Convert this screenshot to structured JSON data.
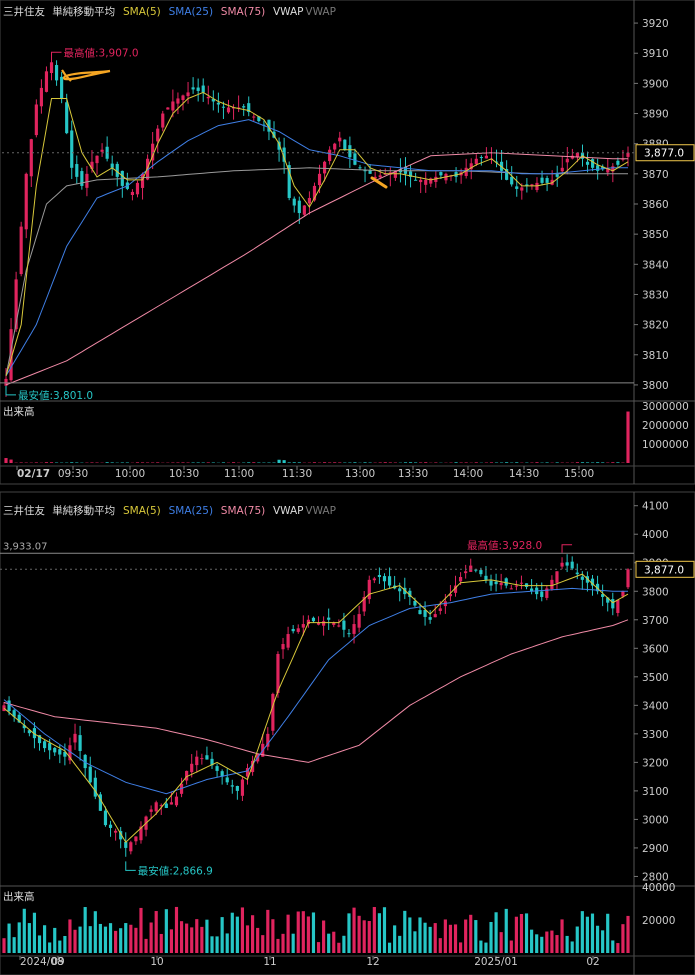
{
  "colors": {
    "up": "#e0245e",
    "down": "#26c6c6",
    "sma5": "#d8c83a",
    "sma25": "#3f7fe6",
    "sma75": "#f08aa6",
    "vwap": "#9a9a9a",
    "high_label": "#e0245e",
    "low_label": "#26c6c6",
    "price_tag": "#f2c94c",
    "annot": "#f5a623"
  },
  "chart_data": [
    {
      "type": "candlestick",
      "panel": "intraday",
      "symbol": "三井住友",
      "indicator_title": "単純移動平均",
      "legend": [
        "SMA(5)",
        "SMA(25)",
        "SMA(75)",
        "VWAP",
        "VWAP"
      ],
      "ylim": [
        3795,
        3925
      ],
      "yticks": [
        3800,
        3810,
        3820,
        3830,
        3840,
        3850,
        3860,
        3870,
        3880,
        3890,
        3900,
        3910,
        3920
      ],
      "xticks": [
        "02/17",
        "09:30",
        "10:00",
        "10:30",
        "11:00",
        "11:30",
        "13:00",
        "13:30",
        "14:00",
        "14:30",
        "15:00"
      ],
      "last_price": "3,877.0",
      "high_label": "最高値:3,907.0",
      "low_label": "最安値:3,801.0",
      "high": 3907.0,
      "low": 3801.0,
      "volume_label": "出来高",
      "volume_ticks": [
        "1000000",
        "2000000",
        "3000000"
      ],
      "volume_ylim": [
        0,
        3200000
      ],
      "n": 124,
      "anchors": [
        [
          0,
          3802
        ],
        [
          2,
          3835
        ],
        [
          4,
          3870
        ],
        [
          6,
          3893
        ],
        [
          8,
          3904
        ],
        [
          9,
          3907
        ],
        [
          11,
          3895
        ],
        [
          13,
          3872
        ],
        [
          15,
          3866
        ],
        [
          17,
          3874
        ],
        [
          19,
          3878
        ],
        [
          21,
          3872
        ],
        [
          23,
          3866
        ],
        [
          25,
          3864
        ],
        [
          27,
          3870
        ],
        [
          29,
          3880
        ],
        [
          31,
          3890
        ],
        [
          33,
          3894
        ],
        [
          35,
          3896
        ],
        [
          37,
          3898
        ],
        [
          39,
          3897
        ],
        [
          41,
          3894
        ],
        [
          43,
          3892
        ],
        [
          45,
          3892
        ],
        [
          47,
          3892
        ],
        [
          49,
          3889
        ],
        [
          51,
          3886
        ],
        [
          53,
          3882
        ],
        [
          55,
          3874
        ],
        [
          56,
          3862
        ],
        [
          58,
          3857
        ],
        [
          60,
          3862
        ],
        [
          62,
          3870
        ],
        [
          64,
          3878
        ],
        [
          66,
          3882
        ],
        [
          67,
          3878
        ],
        [
          69,
          3873
        ],
        [
          71,
          3871
        ],
        [
          73,
          3869
        ],
        [
          75,
          3870
        ],
        [
          77,
          3871
        ],
        [
          79,
          3870
        ],
        [
          81,
          3868
        ],
        [
          83,
          3868
        ],
        [
          85,
          3869
        ],
        [
          87,
          3870
        ],
        [
          89,
          3869
        ],
        [
          91,
          3872
        ],
        [
          93,
          3875
        ],
        [
          95,
          3876
        ],
        [
          97,
          3874
        ],
        [
          99,
          3868
        ],
        [
          101,
          3865
        ],
        [
          103,
          3866
        ],
        [
          105,
          3867
        ],
        [
          107,
          3867
        ],
        [
          109,
          3869
        ],
        [
          111,
          3875
        ],
        [
          113,
          3877
        ],
        [
          115,
          3873
        ],
        [
          117,
          3871
        ],
        [
          119,
          3872
        ],
        [
          121,
          3873
        ],
        [
          123,
          3877
        ]
      ],
      "sma5": [
        [
          0,
          3803
        ],
        [
          3,
          3820
        ],
        [
          6,
          3866
        ],
        [
          9,
          3895
        ],
        [
          12,
          3895
        ],
        [
          15,
          3877
        ],
        [
          18,
          3869
        ],
        [
          21,
          3872
        ],
        [
          24,
          3868
        ],
        [
          27,
          3868
        ],
        [
          30,
          3880
        ],
        [
          33,
          3890
        ],
        [
          36,
          3895
        ],
        [
          39,
          3897
        ],
        [
          42,
          3894
        ],
        [
          45,
          3892
        ],
        [
          48,
          3891
        ],
        [
          51,
          3888
        ],
        [
          54,
          3880
        ],
        [
          57,
          3866
        ],
        [
          60,
          3859
        ],
        [
          63,
          3868
        ],
        [
          66,
          3878
        ],
        [
          69,
          3878
        ],
        [
          72,
          3872
        ],
        [
          75,
          3870
        ],
        [
          78,
          3870
        ],
        [
          81,
          3869
        ],
        [
          84,
          3868
        ],
        [
          87,
          3869
        ],
        [
          90,
          3870
        ],
        [
          93,
          3873
        ],
        [
          96,
          3875
        ],
        [
          99,
          3871
        ],
        [
          102,
          3866
        ],
        [
          105,
          3866
        ],
        [
          108,
          3867
        ],
        [
          111,
          3871
        ],
        [
          114,
          3876
        ],
        [
          117,
          3873
        ],
        [
          120,
          3871
        ],
        [
          123,
          3874
        ]
      ],
      "sma25": [
        [
          0,
          3803
        ],
        [
          6,
          3820
        ],
        [
          12,
          3846
        ],
        [
          18,
          3862
        ],
        [
          24,
          3866
        ],
        [
          30,
          3874
        ],
        [
          36,
          3881
        ],
        [
          42,
          3886
        ],
        [
          48,
          3888
        ],
        [
          54,
          3884
        ],
        [
          60,
          3878
        ],
        [
          66,
          3876
        ],
        [
          72,
          3873
        ],
        [
          78,
          3872
        ],
        [
          84,
          3871
        ],
        [
          90,
          3871
        ],
        [
          96,
          3871
        ],
        [
          102,
          3870
        ],
        [
          108,
          3870
        ],
        [
          114,
          3871
        ],
        [
          120,
          3872
        ],
        [
          123,
          3872
        ]
      ],
      "sma75": [
        [
          0,
          3800
        ],
        [
          12,
          3808
        ],
        [
          24,
          3820
        ],
        [
          36,
          3832
        ],
        [
          48,
          3844
        ],
        [
          60,
          3857
        ],
        [
          72,
          3867
        ],
        [
          84,
          3876
        ],
        [
          96,
          3877
        ],
        [
          108,
          3876
        ],
        [
          120,
          3875
        ],
        [
          123,
          3875
        ]
      ],
      "vwap": [
        [
          0,
          3803
        ],
        [
          4,
          3838
        ],
        [
          8,
          3860
        ],
        [
          12,
          3866
        ],
        [
          18,
          3868
        ],
        [
          30,
          3869
        ],
        [
          45,
          3871
        ],
        [
          60,
          3872
        ],
        [
          75,
          3871
        ],
        [
          90,
          3871
        ],
        [
          105,
          3870
        ],
        [
          123,
          3870
        ]
      ],
      "volume_spikes": [
        [
          0,
          260000
        ],
        [
          1,
          180000
        ],
        [
          54,
          170000
        ],
        [
          55,
          150000
        ],
        [
          123,
          2700000
        ]
      ]
    },
    {
      "type": "candlestick",
      "panel": "daily",
      "symbol": "三井住友",
      "indicator_title": "単純移動平均",
      "legend": [
        "SMA(5)",
        "SMA(25)",
        "SMA(75)",
        "VWAP",
        "VWAP"
      ],
      "ylim": [
        2770,
        4120
      ],
      "yticks": [
        2800,
        2900,
        3000,
        3100,
        3200,
        3300,
        3400,
        3500,
        3600,
        3700,
        3800,
        3900,
        4000,
        4100
      ],
      "xticks": [
        "2024/08",
        "09",
        "10",
        "11",
        "12",
        "2025/01",
        "02"
      ],
      "last_price": "3,877.0",
      "ref_value": "3,933.07",
      "ref_level": 3933.07,
      "high_label": "最高値:3,928.0",
      "low_label": "最安値:2,866.9",
      "high": 3928.0,
      "low": 2866.9,
      "volume_label": "出来高",
      "volume_ticks": [
        "20000",
        "40000"
      ],
      "volume_ylim": [
        0,
        40000
      ],
      "n": 124,
      "anchors": [
        [
          0,
          3400
        ],
        [
          4,
          3320
        ],
        [
          8,
          3250
        ],
        [
          12,
          3220
        ],
        [
          14,
          3300
        ],
        [
          16,
          3180
        ],
        [
          18,
          3080
        ],
        [
          20,
          2980
        ],
        [
          22,
          2960
        ],
        [
          24,
          2900
        ],
        [
          26,
          2940
        ],
        [
          28,
          3010
        ],
        [
          30,
          3060
        ],
        [
          32,
          3040
        ],
        [
          34,
          3080
        ],
        [
          36,
          3170
        ],
        [
          38,
          3220
        ],
        [
          40,
          3210
        ],
        [
          42,
          3170
        ],
        [
          44,
          3130
        ],
        [
          46,
          3100
        ],
        [
          48,
          3180
        ],
        [
          50,
          3230
        ],
        [
          52,
          3300
        ],
        [
          54,
          3580
        ],
        [
          56,
          3650
        ],
        [
          58,
          3670
        ],
        [
          60,
          3700
        ],
        [
          62,
          3690
        ],
        [
          64,
          3700
        ],
        [
          66,
          3680
        ],
        [
          68,
          3650
        ],
        [
          70,
          3720
        ],
        [
          72,
          3840
        ],
        [
          74,
          3850
        ],
        [
          76,
          3820
        ],
        [
          78,
          3800
        ],
        [
          80,
          3780
        ],
        [
          82,
          3720
        ],
        [
          84,
          3700
        ],
        [
          86,
          3740
        ],
        [
          88,
          3790
        ],
        [
          90,
          3850
        ],
        [
          92,
          3890
        ],
        [
          94,
          3860
        ],
        [
          96,
          3820
        ],
        [
          98,
          3830
        ],
        [
          100,
          3810
        ],
        [
          102,
          3830
        ],
        [
          104,
          3800
        ],
        [
          106,
          3780
        ],
        [
          108,
          3840
        ],
        [
          110,
          3900
        ],
        [
          112,
          3880
        ],
        [
          114,
          3840
        ],
        [
          116,
          3820
        ],
        [
          118,
          3780
        ],
        [
          120,
          3740
        ],
        [
          122,
          3800
        ],
        [
          123,
          3877
        ]
      ],
      "sma5": [
        [
          0,
          3390
        ],
        [
          6,
          3300
        ],
        [
          12,
          3240
        ],
        [
          18,
          3100
        ],
        [
          24,
          2920
        ],
        [
          30,
          3020
        ],
        [
          36,
          3150
        ],
        [
          42,
          3200
        ],
        [
          48,
          3140
        ],
        [
          54,
          3450
        ],
        [
          60,
          3690
        ],
        [
          66,
          3690
        ],
        [
          72,
          3790
        ],
        [
          78,
          3820
        ],
        [
          84,
          3720
        ],
        [
          90,
          3830
        ],
        [
          96,
          3840
        ],
        [
          102,
          3820
        ],
        [
          108,
          3820
        ],
        [
          114,
          3860
        ],
        [
          120,
          3760
        ],
        [
          123,
          3790
        ]
      ],
      "sma25": [
        [
          0,
          3420
        ],
        [
          8,
          3300
        ],
        [
          16,
          3200
        ],
        [
          24,
          3130
        ],
        [
          32,
          3090
        ],
        [
          40,
          3140
        ],
        [
          48,
          3170
        ],
        [
          56,
          3360
        ],
        [
          64,
          3560
        ],
        [
          72,
          3680
        ],
        [
          80,
          3740
        ],
        [
          88,
          3760
        ],
        [
          96,
          3790
        ],
        [
          104,
          3800
        ],
        [
          112,
          3810
        ],
        [
          120,
          3800
        ],
        [
          123,
          3800
        ]
      ],
      "sma75": [
        [
          0,
          3410
        ],
        [
          10,
          3360
        ],
        [
          20,
          3340
        ],
        [
          30,
          3320
        ],
        [
          40,
          3280
        ],
        [
          50,
          3230
        ],
        [
          60,
          3200
        ],
        [
          70,
          3260
        ],
        [
          80,
          3400
        ],
        [
          90,
          3500
        ],
        [
          100,
          3580
        ],
        [
          110,
          3640
        ],
        [
          120,
          3680
        ],
        [
          123,
          3700
        ]
      ]
    }
  ]
}
